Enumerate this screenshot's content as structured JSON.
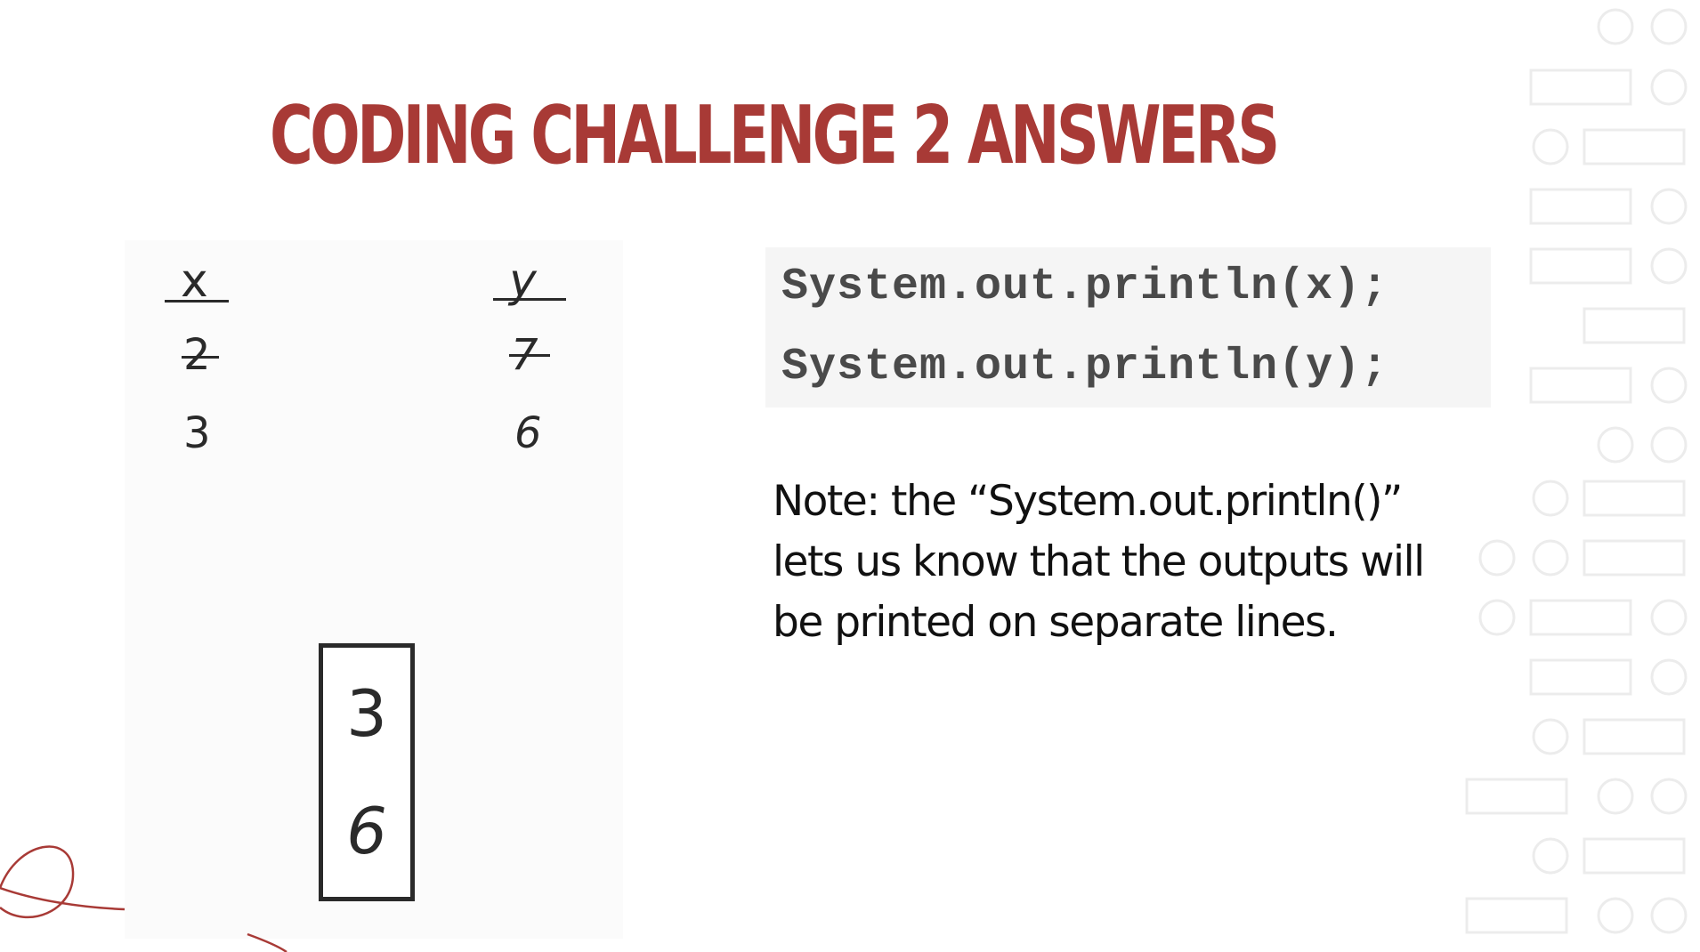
{
  "slide": {
    "title": "CODING CHALLENGE 2 ANSWERS",
    "accent_color": "#a83a36"
  },
  "trace": {
    "x_header": "x",
    "y_header": "y",
    "x_values": [
      "2",
      "3"
    ],
    "y_values": [
      "7",
      "6"
    ],
    "x_crossed_out": "2",
    "y_crossed_out": "7"
  },
  "output": {
    "values": [
      "3",
      "6"
    ]
  },
  "code": {
    "lines": [
      "System.out.println(x);",
      "System.out.println(y);"
    ]
  },
  "note": {
    "text": "Note: the “System.out.println()” lets us know that the outputs will be printed on separate lines."
  }
}
